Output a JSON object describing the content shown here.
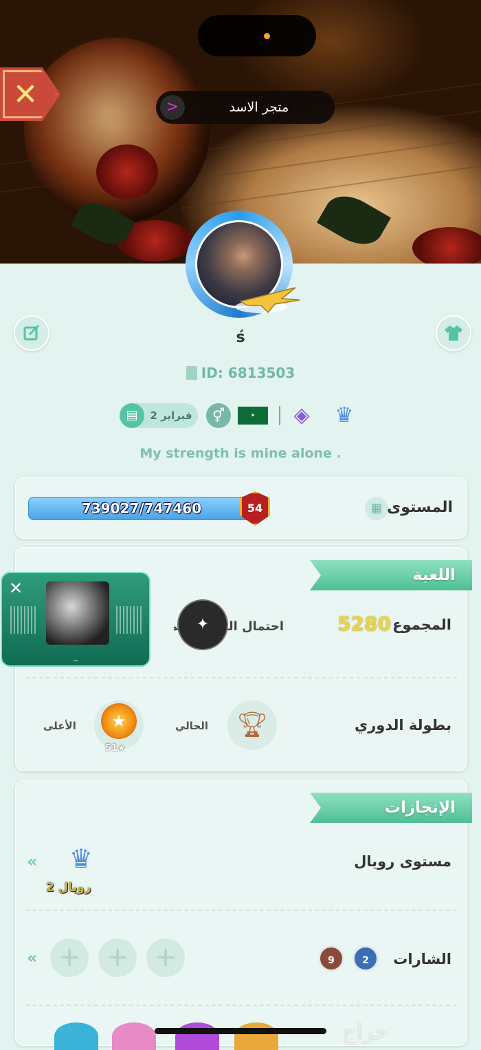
{
  "header": {
    "store_label": "متجر الاسد",
    "store_icon": "share-arrow-icon",
    "close_icon": "close-x-icon"
  },
  "profile": {
    "username": "ś",
    "id_text": "ID: 6813503",
    "birthday": "2 فبراير",
    "gender_icon": "gender-icon",
    "flag": "saudi-flag",
    "bio": "My strength is mine alone ."
  },
  "level": {
    "label": "المستوى",
    "progress_text": "739027/747460",
    "progress_fraction": 0.989,
    "level_number": "54"
  },
  "game": {
    "title": "اللعبة",
    "total_label": "المجموع",
    "total_value": "5280",
    "win_prob_label": "احتمال الفوز الإجمالي",
    "league_label": "بطولة الدوري",
    "current_label": "الحالي",
    "best_label": "الأعلى",
    "best_stars": "51"
  },
  "achievements": {
    "title": "الإنجازات",
    "royal_label": "مستوى رويال",
    "royal_caption": "رويال 2",
    "badges_label": "الشارات",
    "badge_count_a": "2",
    "badge_count_b": "9",
    "empty_slot": "+"
  },
  "music_player": {
    "caption": "_",
    "close": "✕"
  },
  "watermark": "حراج",
  "colors": {
    "background": "#e3f3ef",
    "accent": "#4fbf95",
    "level_bar": "#5fb6ee",
    "total_value": "#e9d34a"
  }
}
